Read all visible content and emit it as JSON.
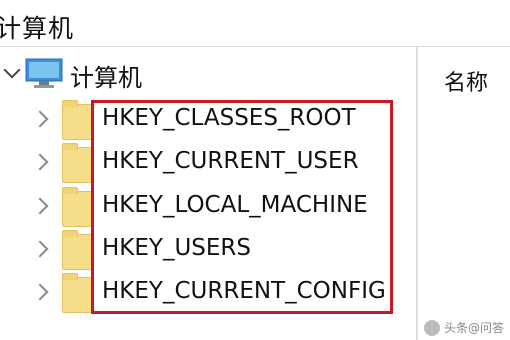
{
  "address_bar": {
    "path": "计算机"
  },
  "tree": {
    "root": {
      "label": "计算机",
      "icon": "computer-icon"
    },
    "keys": [
      {
        "label": "HKEY_CLASSES_ROOT",
        "icon": "folder-icon"
      },
      {
        "label": "HKEY_CURRENT_USER",
        "icon": "folder-icon"
      },
      {
        "label": "HKEY_LOCAL_MACHINE",
        "icon": "folder-icon"
      },
      {
        "label": "HKEY_USERS",
        "icon": "folder-icon"
      },
      {
        "label": "HKEY_CURRENT_CONFIG",
        "icon": "folder-icon"
      }
    ]
  },
  "list": {
    "column_name": "名称"
  },
  "watermark": {
    "text": "头条@问答"
  },
  "colors": {
    "highlight": "#c41a23",
    "folder": "#f6dd8a",
    "monitor": "#3a8fd8"
  }
}
